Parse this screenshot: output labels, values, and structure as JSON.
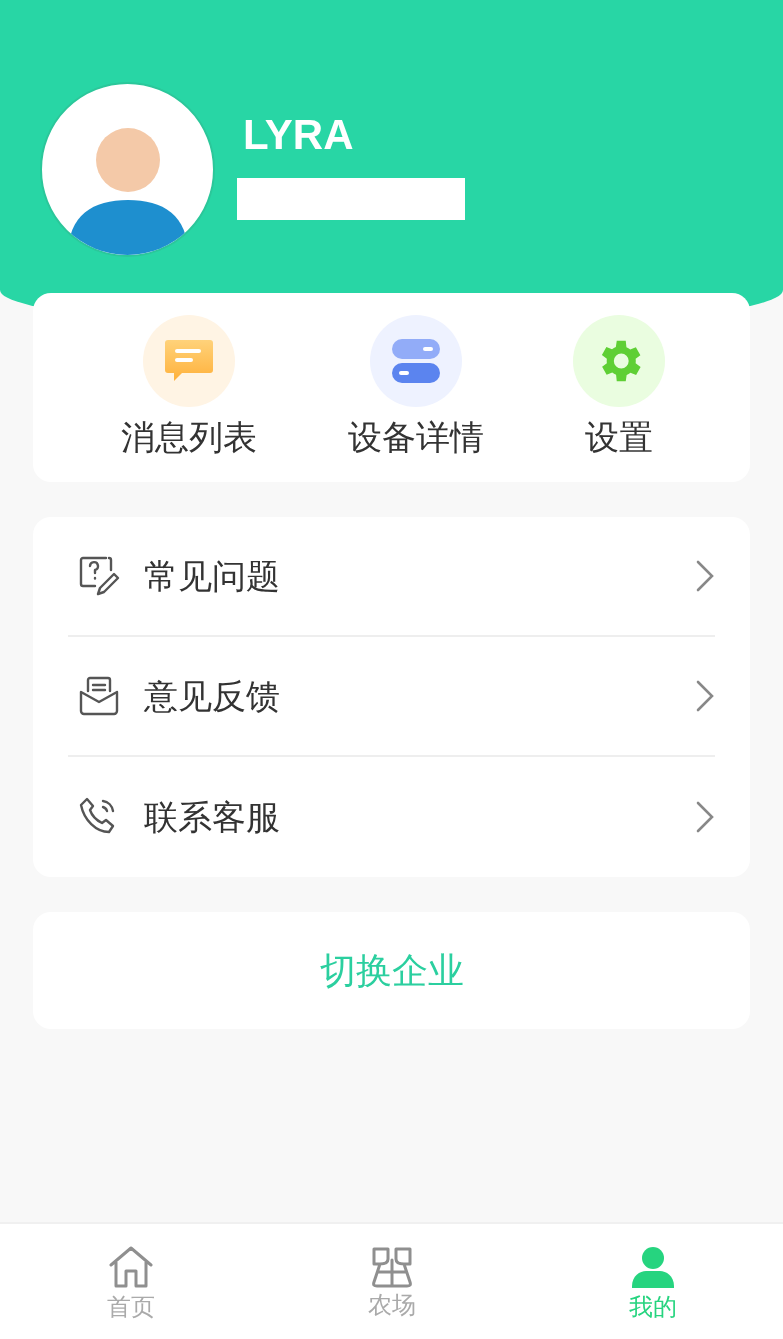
{
  "profile": {
    "name": "LYRA"
  },
  "quick_actions": [
    {
      "kind": "messages",
      "label": "消息列表"
    },
    {
      "kind": "devices",
      "label": "设备详情"
    },
    {
      "kind": "settings",
      "label": "设置"
    }
  ],
  "menu": [
    {
      "kind": "faq",
      "label": "常见问题"
    },
    {
      "kind": "feedback",
      "label": "意见反馈"
    },
    {
      "kind": "support",
      "label": "联系客服"
    }
  ],
  "switch_button": {
    "label": "切换企业"
  },
  "tab_bar": [
    {
      "kind": "home",
      "label": "首页",
      "selected": false
    },
    {
      "kind": "farm",
      "label": "农场",
      "selected": false
    },
    {
      "kind": "profile",
      "label": "我的",
      "selected": true
    }
  ]
}
